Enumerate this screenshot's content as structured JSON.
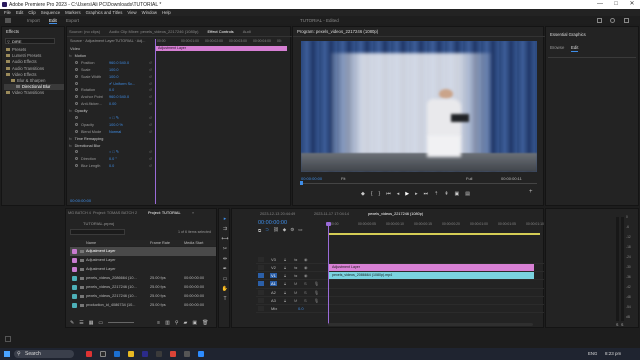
{
  "window": {
    "title": "Adobe Premiere Pro 2023 - C:\\Users\\Ali PC\\Downloads\\TUTORIAL *",
    "controls": [
      "—",
      "□",
      "✕"
    ]
  },
  "menu": [
    "File",
    "Edit",
    "Clip",
    "Sequence",
    "Markers",
    "Graphics and Titles",
    "View",
    "Window",
    "Help"
  ],
  "workspace": {
    "tabs": [
      "Import",
      "Edit",
      "Export"
    ],
    "active": "Edit",
    "center": "TUTORIAL - Edited"
  },
  "effects_panel": {
    "tab": "Effects",
    "search_value": "DIRE",
    "tree": [
      {
        "label": "Presets",
        "level": 0
      },
      {
        "label": "Lumetri Presets",
        "level": 0
      },
      {
        "label": "Audio Effects",
        "level": 0
      },
      {
        "label": "Audio Transitions",
        "level": 0
      },
      {
        "label": "Video Effects",
        "level": 0
      },
      {
        "label": "Blur & Sharpen",
        "level": 1
      },
      {
        "label": "Directional Blur",
        "level": 2,
        "selected": true
      },
      {
        "label": "Video Transitions",
        "level": 0
      }
    ]
  },
  "effect_controls": {
    "header_tabs": [
      "Source: (no clips)",
      "Audio Clip Mixer: pexels_videos_2217246 (1080p)",
      "Effect Controls",
      "Audi"
    ],
    "source_label": "Source · Adjustment Layer",
    "clip_label": "TUTORIAL · Adj...",
    "timecodes": [
      "00:00",
      "00:00:01:00",
      "00:00:02:00",
      "00:00:03:00",
      "00:00:04:00",
      "00:"
    ],
    "clip_bar_label": "Adjustment Layer",
    "video_label": "Video",
    "rows": [
      {
        "name": "Motion",
        "value": "",
        "indent": 0
      },
      {
        "name": "Position",
        "value": "960.0   540.0",
        "indent": 1
      },
      {
        "name": "Scale",
        "value": "100.0",
        "indent": 1
      },
      {
        "name": "Scale Width",
        "value": "100.0",
        "indent": 1
      },
      {
        "name": "",
        "value": "✔ Uniform Sc...",
        "indent": 1
      },
      {
        "name": "Rotation",
        "value": "0.0",
        "indent": 1
      },
      {
        "name": "Anchor Point",
        "value": "960.0   540.0",
        "indent": 1
      },
      {
        "name": "Anti-flicker...",
        "value": "0.00",
        "indent": 1
      },
      {
        "name": "Opacity",
        "value": "",
        "indent": 0
      },
      {
        "name": "",
        "value": "○ □ ✎",
        "indent": 1
      },
      {
        "name": "Opacity",
        "value": "100.0 %",
        "indent": 1
      },
      {
        "name": "Blend Mode",
        "value": "Normal",
        "indent": 1
      },
      {
        "name": "Time Remapping",
        "value": "",
        "indent": 0
      },
      {
        "name": "Directional Blur",
        "value": "",
        "indent": 0
      },
      {
        "name": "",
        "value": "○ □ ✎",
        "indent": 1
      },
      {
        "name": "Direction",
        "value": "0.0 °",
        "indent": 1
      },
      {
        "name": "Blur Length",
        "value": "0.0",
        "indent": 1
      }
    ],
    "footer_time": "00:00:00:00"
  },
  "program_monitor": {
    "tab": "Program: pexels_videos_2217246 (1080p)",
    "timecode": "00:00:00:00",
    "fit": "Fit",
    "quality": "Full",
    "duration": "00:00:00:11"
  },
  "essential_graphics": {
    "tab": "Essential Graphics",
    "subtabs": [
      "Browse",
      "Edit"
    ],
    "active": "Edit"
  },
  "project_panel": {
    "tabs": [
      "MG BATCH 4",
      "Project: TOMAS BATCH 2",
      "Project: TUTORIAL",
      "»"
    ],
    "project_file": "TUTORIAL.prproj",
    "selection_info": "1 of 6 items selected",
    "columns": [
      "Name",
      "Frame Rate",
      "Media Start"
    ],
    "items": [
      {
        "name": "Adjustment Layer",
        "fps": "",
        "start": "",
        "color": "#c97bd1",
        "selected": true
      },
      {
        "name": "Adjustment Layer",
        "fps": "",
        "start": "",
        "color": "#c97bd1",
        "selected": false
      },
      {
        "name": "Adjustment Layer",
        "fps": "",
        "start": "",
        "color": "#c97bd1",
        "selected": false
      },
      {
        "name": "pexels_videos_2086664 (10...",
        "fps": "25.00 fps",
        "start": "00:00:00:00",
        "color": "#4db0b8",
        "selected": false
      },
      {
        "name": "pexels_videos_2217246 (10...",
        "fps": "25.00 fps",
        "start": "00:00:00:00",
        "color": "#4db0b8",
        "selected": false
      },
      {
        "name": "pexels_videos_2217246 (10...",
        "fps": "25.00 fps",
        "start": "00:00:00:00",
        "color": "#4db0b8",
        "selected": false
      },
      {
        "name": "production_id_4086734 (10...",
        "fps": "25.00 fps",
        "start": "00:00:00:00",
        "color": "#4db0b8",
        "selected": false
      }
    ]
  },
  "timeline": {
    "tabs": [
      "2023-12-13 20:44:49",
      "2023-11-17 17:04:14",
      "pexels_videos_2217246 (1080p)"
    ],
    "active_tab": "pexels_videos_2217246 (1080p)",
    "timecode": "00:00:00:00",
    "ruler": [
      "00:00",
      "00:00:00:05",
      "00:00:00:10",
      "00:00:00:15",
      "00:00:00:20",
      "00:00:01:00",
      "00:00:01:05",
      "00:00:01:10"
    ],
    "tracks": [
      "V3",
      "V2",
      "V1",
      "A1",
      "A2",
      "A3",
      "Mix"
    ],
    "mix_value": "0.0",
    "clips": [
      {
        "label": "Adjustment Layer",
        "track": "V2",
        "color": "#d880d4"
      },
      {
        "label": "pexels_videos_2086664 (1080p).mp4",
        "track": "V1",
        "color": "#7ad3e0"
      }
    ],
    "meter_labels": [
      "0",
      "-6",
      "-12",
      "-18",
      "-24",
      "-30",
      "-36",
      "-42",
      "-48",
      "-54",
      "dB"
    ]
  },
  "taskbar": {
    "search_placeholder": "Search",
    "language": "ENG",
    "time": "8:23 pm"
  },
  "colors": {
    "accent_blue": "#3f8ee8",
    "clip_pink": "#d880d4",
    "clip_cyan": "#7ad3e0",
    "playhead": "#9a6bd8"
  }
}
